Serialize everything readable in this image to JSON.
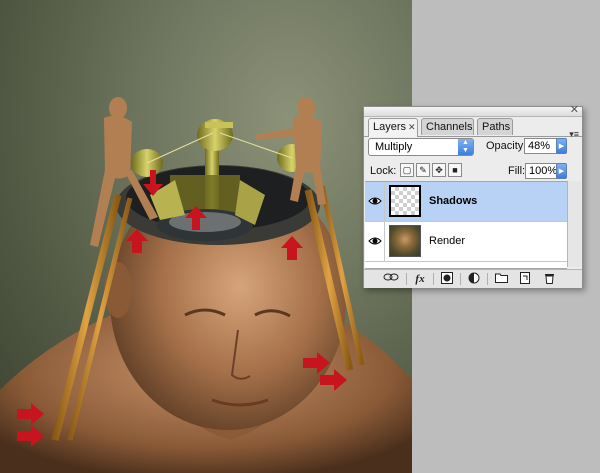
{
  "layers_panel": {
    "tabs": [
      {
        "label": "Layers",
        "close": "✕"
      },
      {
        "label": "Channels"
      },
      {
        "label": "Paths"
      }
    ],
    "close_glyph": "✕",
    "menu_glyph": "▾≡",
    "blend_mode": "Multiply",
    "opacity_label": "Opacity:",
    "opacity_value": "48%",
    "lock_label": "Lock:",
    "fill_label": "Fill:",
    "fill_value": "100%",
    "layers": [
      {
        "name": "Shadows",
        "selected": true,
        "visible": true
      },
      {
        "name": "Render",
        "selected": false,
        "visible": true
      }
    ],
    "footer_buttons": [
      "link-icon",
      "fx-icon",
      "mask-icon",
      "adjustment-icon",
      "group-folder-icon",
      "new-layer-icon",
      "trash-icon"
    ],
    "footer_fx_label": "fx"
  },
  "colors": {
    "arrow_red": "#c8141e",
    "selection_blue": "#b7d2f5",
    "ladder_wood": "#c98a2a"
  }
}
